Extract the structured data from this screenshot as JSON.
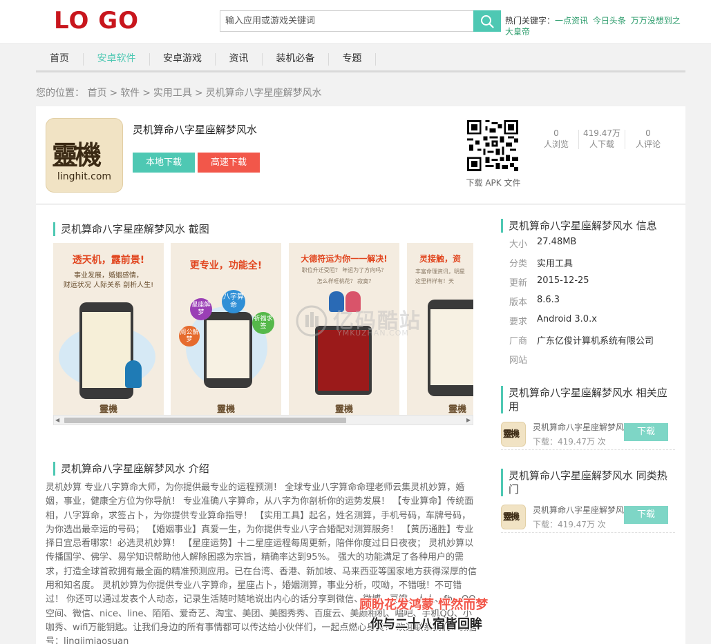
{
  "header": {
    "logo": "LO GO",
    "search_placeholder": "输入应用或游戏关键词",
    "hot_label": "热门关键字：",
    "hot_keywords": [
      "一点资讯",
      "今日头条",
      "万万没想到之大皇帝"
    ]
  },
  "nav": {
    "items": [
      "首页",
      "安卓软件",
      "安卓游戏",
      "资讯",
      "装机必备",
      "专题"
    ],
    "active": "安卓软件"
  },
  "breadcrumb": {
    "label": "您的位置：",
    "items": [
      "首页",
      "软件",
      "实用工具",
      "灵机算命八字星座解梦风水"
    ]
  },
  "app": {
    "name": "灵机算命八字星座解梦风水",
    "icon_text": "靈機",
    "icon_sub": "linghit.com",
    "btn_local": "本地下载",
    "btn_fast": "高速下载",
    "qr_label": "下载 APK 文件",
    "stats": [
      {
        "value": "0",
        "label": "人浏览"
      },
      {
        "value": "419.47万",
        "label": "人下载"
      },
      {
        "value": "0",
        "label": "人评论"
      }
    ]
  },
  "screenshots": {
    "title": "灵机算命八字星座解梦风水 截图",
    "shots": [
      {
        "headline": "透天机，露前景!",
        "caption1": "事业发展，婚姻感情，",
        "caption2": "财运状况 人际关系 剖析人生!"
      },
      {
        "headline": "更专业，功能全!",
        "caption1": "",
        "caption2": ""
      },
      {
        "headline": "大德符运为你一一解决!",
        "caption1": "职位升迁受阻？  年运为了方向吗？",
        "caption2": "怎么样旺桃花？  寂寞?"
      },
      {
        "headline": "灵接触，资",
        "caption1": "丰富命理资讯，明星",
        "caption2": "这里样样有！天"
      }
    ],
    "bubbles": [
      "星座解梦",
      "八字算命",
      "祈福求签",
      "周公解梦"
    ],
    "brand": "靈機"
  },
  "intro": {
    "title": "灵机算命八字星座解梦风水 介绍",
    "text": "灵机妙算 专业八字算命大师，为你提供最专业的运程预测！ 全球专业八字算命命理老师云集灵机妙算，婚姻，事业，健康全方位为你导航！ 专业准确八字算命，从八字为你剖析你的运势发展！ 【专业算命】传统面相，八字算命，求签占卜，为你提供专业算命指导！ 【实用工具】起名，姓名测算，手机号码，车牌号码，为你选出最幸运的号码； 【婚姻事业】真爱一生，为你提供专业八字合婚配对测算服务！ 【黄历通胜】专业择日宜忌看哪家！必选灵机妙算！ 【星座运势】十二星座运程每周更新，陪伴你度过日日夜夜； 灵机妙算以传播国学、佛学、易学知识帮助他人解除困惑为宗旨，精确率达到95%。 强大的功能满足了各种用户的需求，打造全球首款拥有最全面的精准预测应用。已在台湾、香港、新加坡、马来西亚等国家地方获得深厚的信用和知名度。 灵机妙算为你提供专业八字算命，星座占卜，婚姻测算，事业分析，哎呦，不错哦！不可错过！ 你还可以通过发表个人动态，记录生活随时随地说出内心的话分享到微信、微博、豆瓣、人人、fb、QQ空间、微信、nice、line、陌陌、爱奇艺、淘宝、美团、美图秀秀、百度云、美颜相机、唱吧、手机QQ、小咖秀、wifi万能钥匙。让我们身边的所有事情都可以传达给小伙伴们，一起点燃心身灵！ 欢迎联系我们：微信号：lingjimiaosuan"
  },
  "info": {
    "title": "灵机算命八字星座解梦风水 信息",
    "rows": [
      {
        "k": "大小",
        "v": "27.48MB"
      },
      {
        "k": "分类",
        "v": "实用工具"
      },
      {
        "k": "更新",
        "v": "2015-12-25"
      },
      {
        "k": "版本",
        "v": "8.6.3"
      },
      {
        "k": "要求",
        "v": "Android 3.0.x"
      },
      {
        "k": "厂商",
        "v": "广东亿俊计算机系统有限公司"
      },
      {
        "k": "网站",
        "v": ""
      }
    ]
  },
  "related": {
    "title": "灵机算命八字星座解梦风水 相关应用",
    "items": [
      {
        "name": "灵机算命八字星座解梦风水",
        "downloads": "下载：419.47万 次",
        "btn": "下载"
      }
    ]
  },
  "hot_similar": {
    "title": "灵机算命八字星座解梦风水 同类热门",
    "items": [
      {
        "name": "灵机算命八字星座解梦风水",
        "downloads": "下载：419.47万 次",
        "btn": "下载"
      }
    ]
  },
  "watermark": {
    "main": "亿码酷站",
    "sub": "YMKUZHAN.COM"
  },
  "overlay": {
    "line1": "顾盼花发鸿蒙 怦然而梦",
    "line2": "你与二十八宿皆回眸"
  },
  "colors": {
    "accent": "#4ec8b3",
    "download_red": "#f2574a",
    "logo_red": "#c8161d",
    "link_green": "#2a9b6a"
  }
}
